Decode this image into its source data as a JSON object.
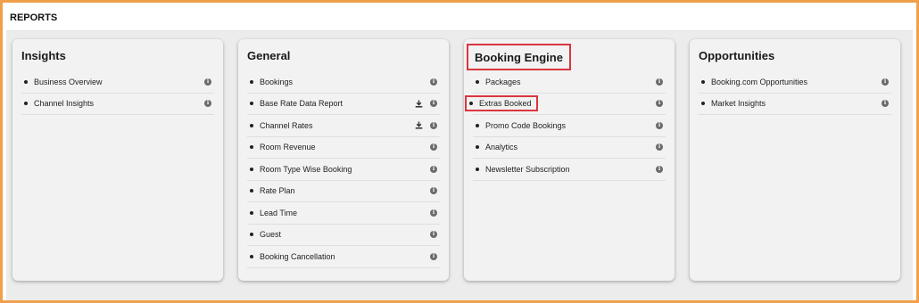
{
  "page": {
    "title": "REPORTS"
  },
  "cards": [
    {
      "title": "Insights",
      "items": [
        {
          "label": "Business Overview",
          "download": false
        },
        {
          "label": "Channel Insights",
          "download": false
        }
      ]
    },
    {
      "title": "General",
      "items": [
        {
          "label": "Bookings",
          "download": false
        },
        {
          "label": "Base Rate Data Report",
          "download": true
        },
        {
          "label": "Channel Rates",
          "download": true
        },
        {
          "label": "Room Revenue",
          "download": false
        },
        {
          "label": "Room Type Wise Booking",
          "download": false
        },
        {
          "label": "Rate Plan",
          "download": false
        },
        {
          "label": "Lead Time",
          "download": false
        },
        {
          "label": "Guest",
          "download": false
        },
        {
          "label": "Booking Cancellation",
          "download": false
        }
      ]
    },
    {
      "title": "Booking Engine",
      "highlighted": true,
      "items": [
        {
          "label": "Packages",
          "download": false
        },
        {
          "label": "Extras Booked",
          "download": false,
          "highlighted": true
        },
        {
          "label": "Promo Code Bookings",
          "download": false
        },
        {
          "label": "Analytics",
          "download": false
        },
        {
          "label": "Newsletter Subscription",
          "download": false
        }
      ]
    },
    {
      "title": "Opportunities",
      "items": [
        {
          "label": "Booking.com Opportunities",
          "download": false
        },
        {
          "label": "Market Insights",
          "download": false
        }
      ]
    }
  ],
  "icons": {
    "info": "info-icon",
    "download": "download-icon"
  },
  "colors": {
    "frame": "#f0a04b",
    "highlight": "#d9363e",
    "info_icon": "#6b6b6b"
  }
}
